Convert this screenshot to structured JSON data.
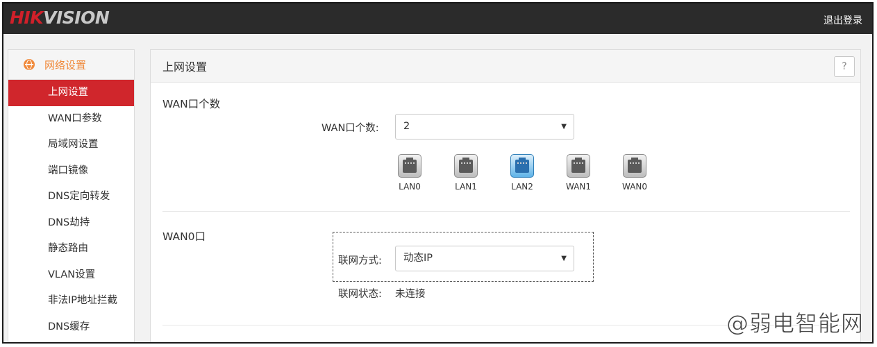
{
  "header": {
    "logo_hik": "HIK",
    "logo_vision": "VISION",
    "logout": "退出登录"
  },
  "sidebar": {
    "section": "网络设置",
    "items": [
      {
        "label": "上网设置",
        "active": true
      },
      {
        "label": "WAN口参数"
      },
      {
        "label": "局域网设置"
      },
      {
        "label": "端口镜像"
      },
      {
        "label": "DNS定向转发"
      },
      {
        "label": "DNS劫持"
      },
      {
        "label": "静态路由"
      },
      {
        "label": "VLAN设置"
      },
      {
        "label": "非法IP地址拦截"
      },
      {
        "label": "DNS缓存"
      }
    ]
  },
  "panel": {
    "title": "上网设置",
    "help": "?",
    "wan_count_section": "WAN口个数",
    "wan_count_label": "WAN口个数:",
    "wan_count_value": "2",
    "ports": [
      {
        "label": "LAN0",
        "active": false
      },
      {
        "label": "LAN1",
        "active": false
      },
      {
        "label": "LAN2",
        "active": true
      },
      {
        "label": "WAN1",
        "active": false
      },
      {
        "label": "WAN0",
        "active": false
      }
    ],
    "wan0_section": "WAN0口",
    "conn_type_label": "联网方式:",
    "conn_type_value": "动态IP",
    "conn_status_label": "联网状态:",
    "conn_status_value": "未连接"
  },
  "watermark": "@弱电智能网",
  "colors": {
    "accent": "#d0262c",
    "section_orange": "#f08a3c",
    "topbar": "#2b2b2b",
    "port_active": "#5fb3e8"
  },
  "icons": {
    "section": "globe-icon",
    "dropdown": "chevron-down-icon",
    "port": "ethernet-port-icon"
  }
}
